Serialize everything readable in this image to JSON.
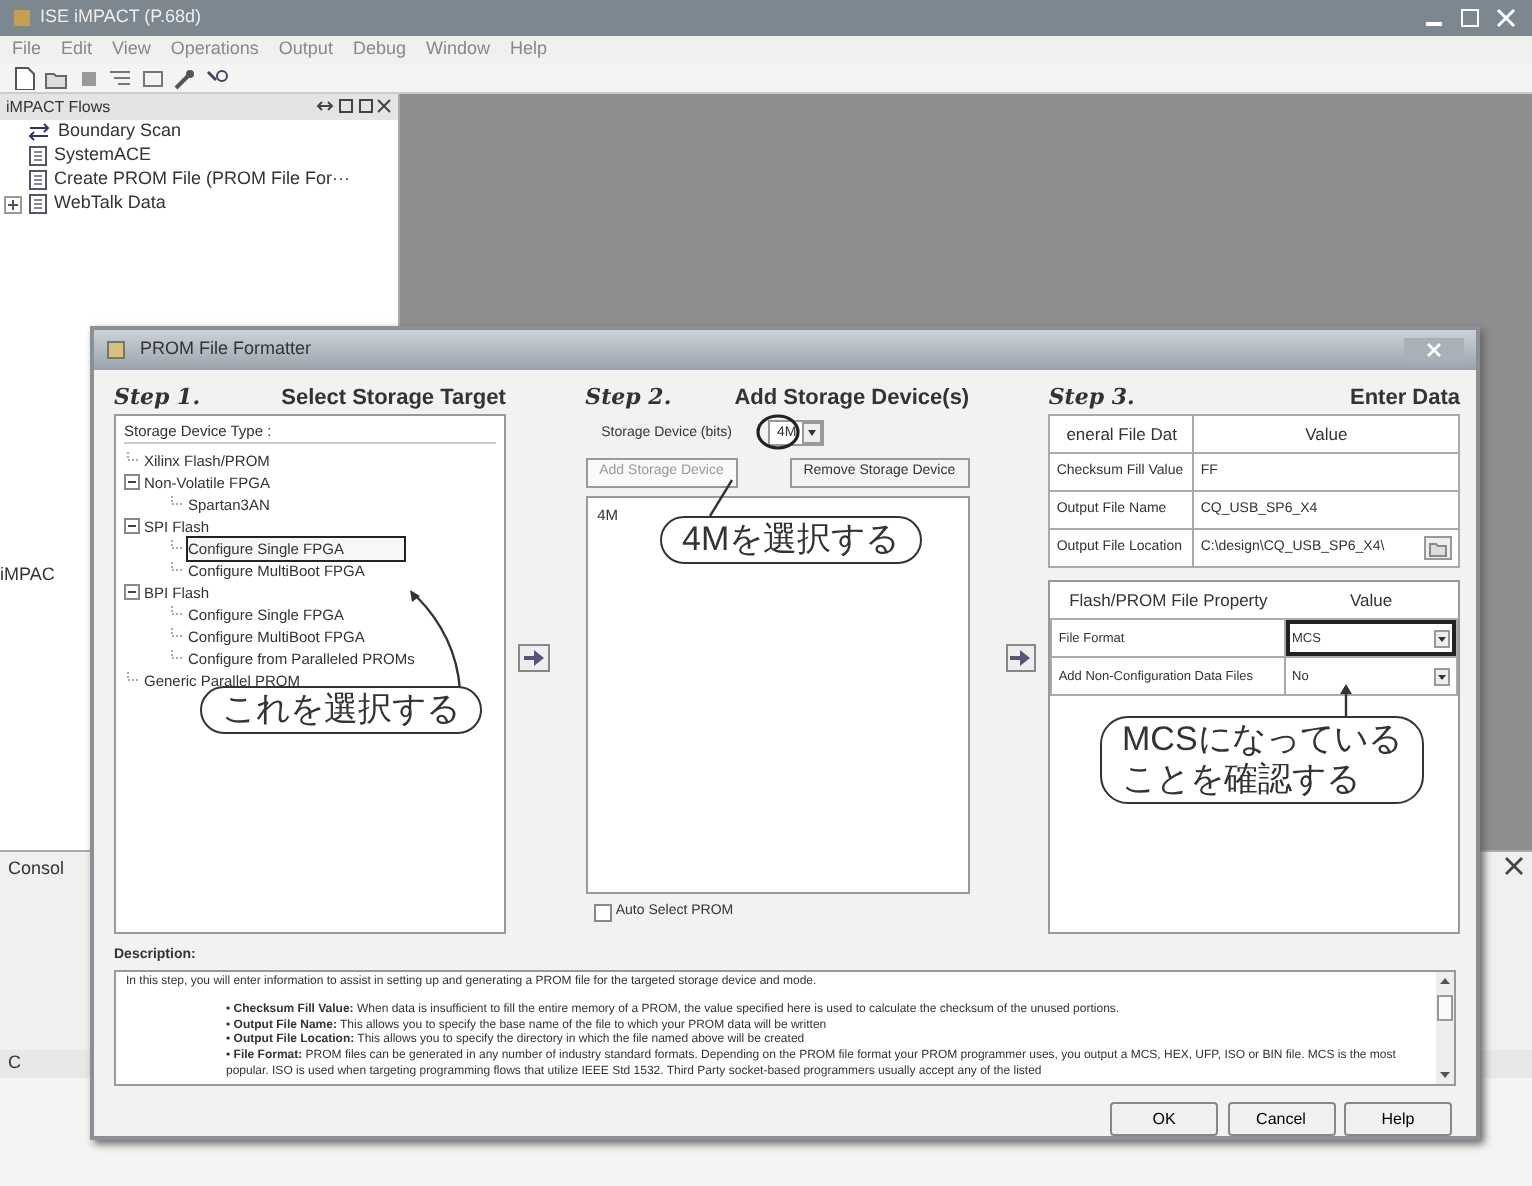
{
  "app": {
    "title": "ISE iMPACT (P.68d)",
    "menu": [
      "File",
      "Edit",
      "View",
      "Operations",
      "Output",
      "Debug",
      "Window",
      "Help"
    ],
    "flows_panel": {
      "title": "iMPACT Flows",
      "items": [
        {
          "label": "Boundary Scan",
          "kind": "scan",
          "expandable": false
        },
        {
          "label": "SystemACE",
          "kind": "doc",
          "expandable": false
        },
        {
          "label": "Create PROM File (PROM File For···",
          "kind": "doc",
          "expandable": false
        },
        {
          "label": "WebTalk Data",
          "kind": "doc",
          "expandable": true
        }
      ]
    },
    "hidden_panel_label": "iMPAC",
    "console_label": "Consol",
    "status_label": "C"
  },
  "dialog": {
    "title": "PROM File Formatter",
    "step1": {
      "step": "Step 1.",
      "heading": "Select Storage Target",
      "tree_title": "Storage Device Type :",
      "tree": [
        {
          "label": "Xilinx Flash/PROM",
          "selected": false
        },
        {
          "label": "Non-Volatile FPGA",
          "expanded": true,
          "children": [
            {
              "label": "Spartan3AN",
              "selected": false
            }
          ]
        },
        {
          "label": "SPI Flash",
          "expanded": true,
          "children": [
            {
              "label": "Configure Single FPGA",
              "selected": true
            },
            {
              "label": "Configure MultiBoot FPGA",
              "selected": false
            }
          ]
        },
        {
          "label": "BPI Flash",
          "expanded": true,
          "children": [
            {
              "label": "Configure Single FPGA",
              "selected": false
            },
            {
              "label": "Configure MultiBoot FPGA",
              "selected": false
            },
            {
              "label": "Configure from Paralleled PROMs",
              "selected": false
            }
          ]
        },
        {
          "label": "Generic Parallel PROM",
          "selected": false
        }
      ]
    },
    "step2": {
      "step": "Step 2.",
      "heading": "Add Storage Device(s)",
      "size_label": "Storage Device (bits)",
      "size_value": "4M",
      "add_button": {
        "label": "Add Storage Device",
        "disabled": true
      },
      "remove_button": {
        "label": "Remove Storage Device",
        "disabled": false
      },
      "devices": [
        "4M"
      ],
      "auto_select": {
        "label": "Auto Select PROM",
        "checked": false
      }
    },
    "step3": {
      "step": "Step 3.",
      "heading": "Enter Data",
      "general": {
        "columns": [
          "eneral File Dat",
          "Value"
        ],
        "rows": [
          {
            "name": "Checksum Fill Value",
            "value": "FF",
            "browse": false
          },
          {
            "name": "Output File Name",
            "value": "CQ_USB_SP6_X4",
            "browse": false
          },
          {
            "name": "Output File Location",
            "value": "C:\\design\\CQ_USB_SP6_X4\\",
            "browse": true
          }
        ]
      },
      "properties": {
        "columns": [
          "Flash/PROM File Property",
          "Value"
        ],
        "rows": [
          {
            "name": "File Format",
            "value": "MCS",
            "highlighted": true
          },
          {
            "name": "Add Non-Configuration Data Files",
            "value": "No",
            "highlighted": false
          }
        ]
      }
    },
    "description": {
      "label": "Description:",
      "intro": "In this step, you will enter information to assist in setting up and generating a PROM file for the targeted storage device and mode.",
      "bullets": [
        "• **Checksum Fill Value:** When data is insufficient to fill the entire memory of a PROM, the value specified here is used to calculate the checksum of the unused portions.",
        "• **Output File Name:** This allows you to specify the base name of the file to which your PROM data will be written",
        "• **Output File Location:** This allows you to specify the directory in which the file named above will be created",
        "• **File Format:** PROM files can be generated in any number of industry standard formats. Depending on the PROM file format your PROM programmer uses, you output a MCS, HEX, UFP, ISO or BIN file. MCS is the most popular. ISO is used when targeting programming flows that utilize IEEE Std 1532. Third Party socket-based programmers usually accept any of the listed"
      ]
    },
    "buttons": [
      "OK",
      "Cancel",
      "Help"
    ]
  },
  "callouts": [
    {
      "lines": [
        "これを選択する"
      ]
    },
    {
      "lines": [
        "4Mを選択する"
      ]
    },
    {
      "lines": [
        "MCSになっている",
        "ことを確認する"
      ]
    }
  ]
}
